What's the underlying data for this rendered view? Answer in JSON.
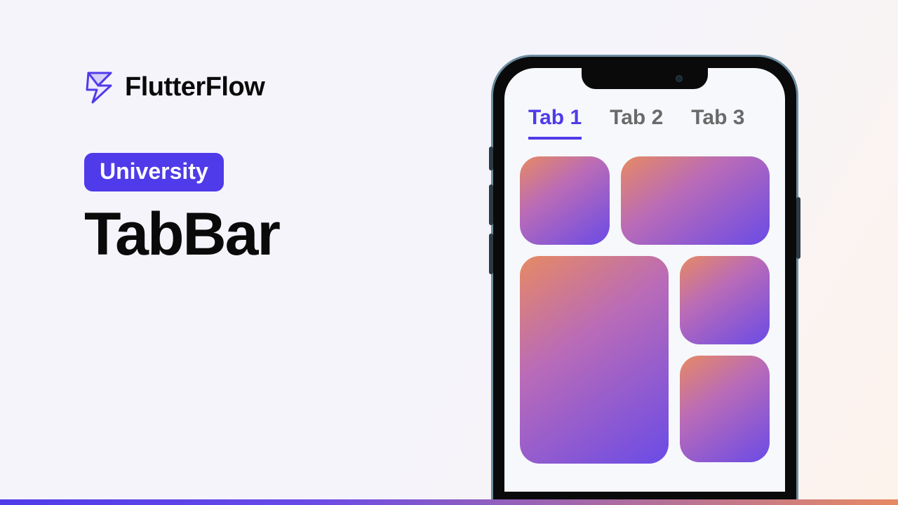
{
  "brand": {
    "name": "FlutterFlow",
    "logo_color": "#4f3be9"
  },
  "badge": {
    "label": "University",
    "bg": "#4f3be9"
  },
  "title": "TabBar",
  "phone": {
    "tabs": [
      {
        "label": "Tab 1",
        "active": true
      },
      {
        "label": "Tab 2",
        "active": false
      },
      {
        "label": "Tab 3",
        "active": false
      }
    ]
  },
  "colors": {
    "accent": "#4f3be9",
    "gradient_start": "#e78a63",
    "gradient_end": "#6a4be6"
  }
}
